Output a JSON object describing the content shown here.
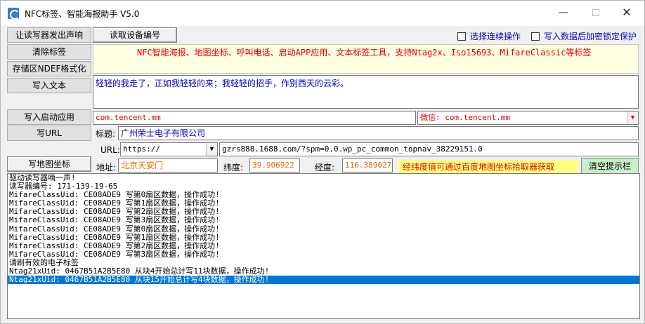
{
  "window": {
    "title": "NFC标签、智能海报助手 V5.0",
    "minimize_glyph": "—",
    "close_glyph": "✕"
  },
  "buttons": {
    "beep": "让读写器发出声响",
    "read_id": "读取设备编号",
    "clear_tag": "清除标签",
    "ndef_format": "存储区NDEF格式化",
    "write_text": "写入文本",
    "write_app": "写入启动应用",
    "write_url": "写URL",
    "write_map": "写地图坐标",
    "clear_log": "清空提示栏"
  },
  "options": {
    "continuous": "选择连续操作",
    "lock_after_write": "写入数据后加密锁定保护"
  },
  "banner_text": "NFC智能海报、地图坐标、呼叫电话、启动APP应用、文本标签工具，支持Ntag2x、Iso15693、MifareClassic等标签",
  "text_content": "轻轻的我走了，正如我轻轻的来；我轻轻的招手，作别西天的云彩。",
  "app": {
    "package": "com.tencent.mm",
    "wechat_option": "微信: com.tencent.mm"
  },
  "title_field": {
    "label": "标题:",
    "value": "广州荣士电子有限公司"
  },
  "url": {
    "label": "URL:",
    "scheme": "https://",
    "value": "gzrs888.1688.com/?spm=0.0.wp_pc_common_topnav_38229151.0"
  },
  "map": {
    "address_label": "地址:",
    "address": "北京天安门",
    "lat_label": "纬度:",
    "lat": "39.906922",
    "lng_label": "经度:",
    "lng": "116.389027",
    "hint": "经纬度值可通过百度地图坐标拾取器获取"
  },
  "log": [
    "驱动读写器嘀一声!",
    "读写器编号: 171-139-19-65",
    "MifareClassUid: CE08ADE9 写第0扇区数据，操作成功!",
    "MifareClassUid: CE08ADE9 写第1扇区数据，操作成功!",
    "MifareClassUid: CE08ADE9 写第2扇区数据，操作成功!",
    "MifareClassUid: CE08ADE9 写第3扇区数据，操作成功!",
    "MifareClassUid: CE08ADE9 写第0扇区数据，操作成功!",
    "MifareClassUid: CE08ADE9 写第1扇区数据，操作成功!",
    "MifareClassUid: CE08ADE9 写第2扇区数据，操作成功!",
    "MifareClassUid: CE08ADE9 写第3扇区数据，操作成功!",
    "请刷有效的电子标签",
    "Ntag21xUid: 0467B51A2B5E80 从块4开始总计写11块数据，操作成功!",
    "Ntag21xUid: 0467B51A2B5E80 从块15开始总计写4块数据，操作成功!"
  ],
  "log_selected_index": 12
}
